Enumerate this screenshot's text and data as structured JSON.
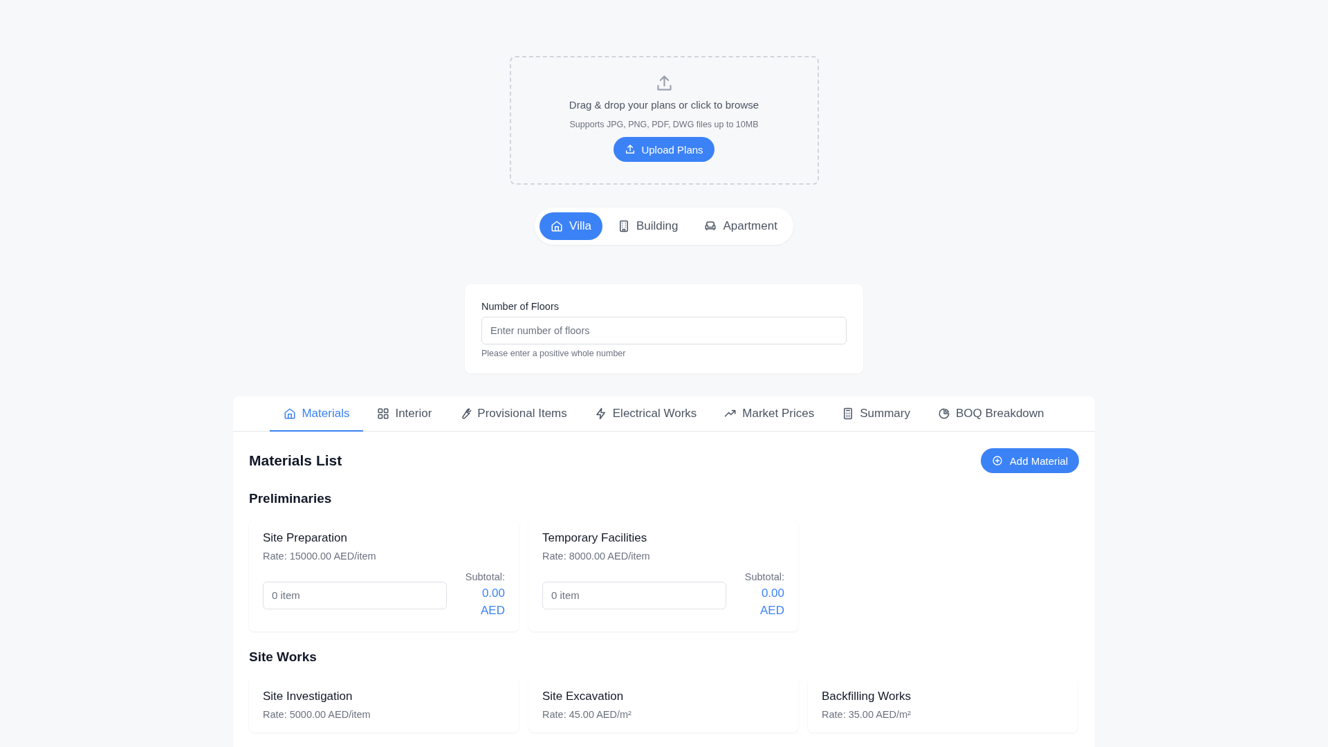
{
  "upload": {
    "title": "Drag & drop your plans or click to browse",
    "hint": "Supports JPG, PNG, PDF, DWG files up to 10MB",
    "button": "Upload Plans"
  },
  "property_types": [
    {
      "label": "Villa",
      "kind": "house",
      "selected": true
    },
    {
      "label": "Building",
      "kind": "building",
      "selected": false
    },
    {
      "label": "Apartment",
      "kind": "sofa",
      "selected": false
    }
  ],
  "floors": {
    "label": "Number of Floors",
    "placeholder": "Enter number of floors",
    "hint": "Please enter a positive whole number"
  },
  "tabs": [
    {
      "label": "Materials",
      "kind": "house",
      "selected": true
    },
    {
      "label": "Interior",
      "kind": "grid",
      "selected": false
    },
    {
      "label": "Provisional Items",
      "kind": "wrench",
      "selected": false
    },
    {
      "label": "Electrical Works",
      "kind": "bolt",
      "selected": false
    },
    {
      "label": "Market Prices",
      "kind": "trend",
      "selected": false
    },
    {
      "label": "Summary",
      "kind": "calculator",
      "selected": false
    },
    {
      "label": "BOQ Breakdown",
      "kind": "pie",
      "selected": false
    }
  ],
  "materials": {
    "title": "Materials List",
    "add_button": "Add Material",
    "sections": [
      {
        "title": "Preliminaries",
        "items": [
          {
            "name": "Site Preparation",
            "rate": "Rate: 15000.00 AED/item",
            "placeholder": "0 item",
            "subtotal_label": "Subtotal:",
            "subtotal": "0.00 AED"
          },
          {
            "name": "Temporary Facilities",
            "rate": "Rate: 8000.00 AED/item",
            "placeholder": "0 item",
            "subtotal_label": "Subtotal:",
            "subtotal": "0.00 AED"
          }
        ]
      },
      {
        "title": "Site Works",
        "items": [
          {
            "name": "Site Investigation",
            "rate": "Rate: 5000.00 AED/item"
          },
          {
            "name": "Site Excavation",
            "rate": "Rate: 45.00 AED/m²"
          },
          {
            "name": "Backfilling Works",
            "rate": "Rate: 35.00 AED/m²"
          }
        ]
      }
    ]
  }
}
